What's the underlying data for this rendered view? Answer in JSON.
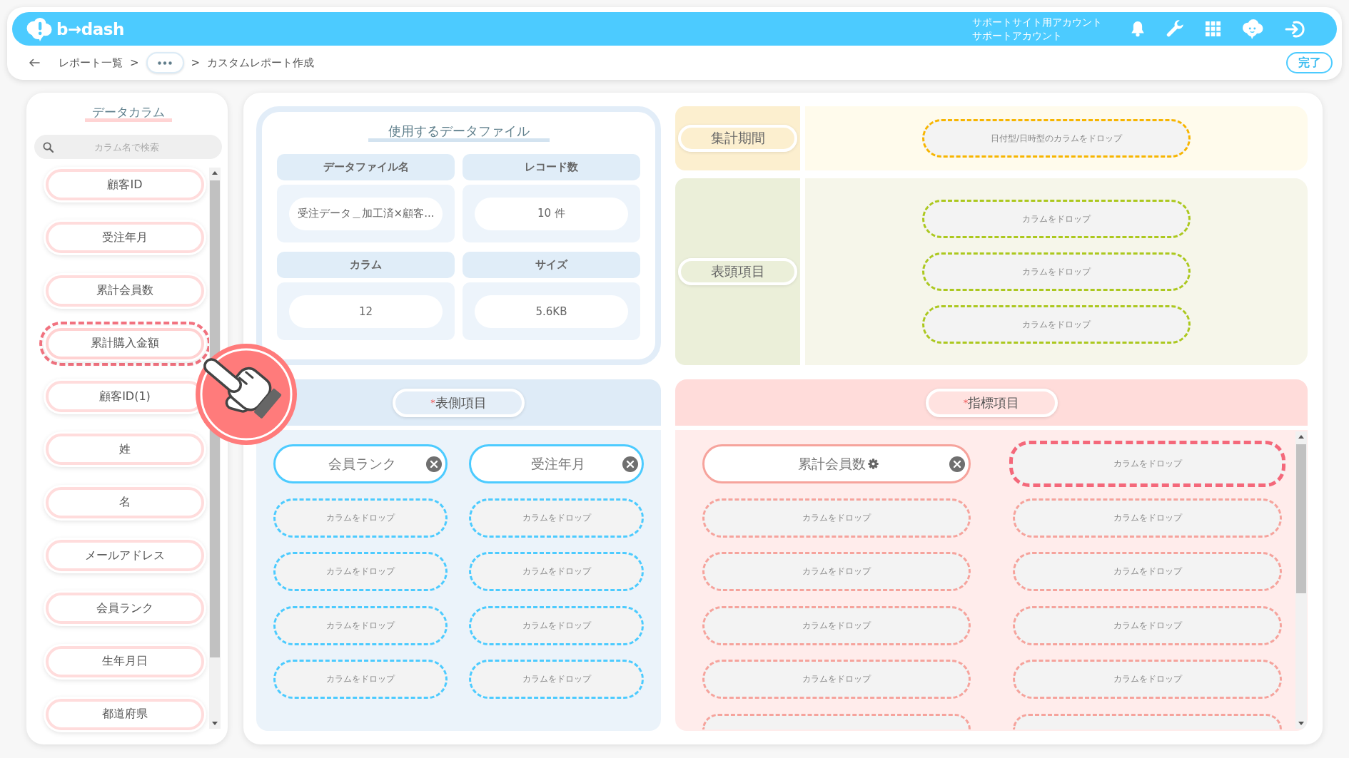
{
  "header": {
    "logo": "b→dash",
    "account_lines": [
      "サポートサイト用アカウント",
      "サポートアカウント"
    ]
  },
  "breadcrumb": [
    {
      "kind": "link",
      "label": "レポート一覧"
    },
    {
      "kind": "separator",
      "label": ">"
    },
    {
      "kind": "more"
    },
    {
      "kind": "separator",
      "label": ">"
    },
    {
      "kind": "current",
      "label": "カスタムレポート作成"
    }
  ],
  "done_button": "完了",
  "sidebar": {
    "title": "データカラム",
    "search": {
      "placeholder": "カラム名で検索"
    },
    "items": [
      {
        "label": "顧客ID",
        "dragging": false
      },
      {
        "label": "受注年月",
        "dragging": false
      },
      {
        "label": "累計会員数",
        "dragging": false
      },
      {
        "label": "累計購入金額",
        "dragging": true
      },
      {
        "label": "顧客ID(1)",
        "dragging": false
      },
      {
        "label": "姓",
        "dragging": false
      },
      {
        "label": "名",
        "dragging": false
      },
      {
        "label": "メールアドレス",
        "dragging": false
      },
      {
        "label": "会員ランク",
        "dragging": false
      },
      {
        "label": "生年月日",
        "dragging": false
      },
      {
        "label": "都道府県",
        "dragging": false
      }
    ]
  },
  "data_file": {
    "title": "使用するデータファイル",
    "fields": [
      {
        "label": "データファイル名",
        "value": "受注データ＿加工済×顧客..."
      },
      {
        "label": "レコード数",
        "value": "10 件"
      },
      {
        "label": "カラム",
        "value": "12"
      },
      {
        "label": "サイズ",
        "value": "5.6KB"
      }
    ]
  },
  "period": {
    "label": "集計期間",
    "slots": [
      {
        "kind": "drop",
        "placeholder": "日付型/日時型のカラムをドロップ"
      }
    ]
  },
  "column_header": {
    "label": "表頭項目",
    "slots": [
      {
        "kind": "drop",
        "placeholder": "カラムをドロップ"
      },
      {
        "kind": "drop",
        "placeholder": "カラムをドロップ"
      },
      {
        "kind": "drop",
        "placeholder": "カラムをドロップ"
      }
    ]
  },
  "row_header": {
    "label": "$^{*}$表側項目",
    "slots": [
      {
        "kind": "column",
        "label": "会員ランク",
        "settings": false
      },
      {
        "kind": "column",
        "label": "受注年月",
        "settings": false
      },
      {
        "kind": "drop",
        "placeholder": "カラムをドロップ"
      },
      {
        "kind": "drop",
        "placeholder": "カラムをドロップ"
      },
      {
        "kind": "drop",
        "placeholder": "カラムをドロップ"
      },
      {
        "kind": "drop",
        "placeholder": "カラムをドロップ"
      },
      {
        "kind": "drop",
        "placeholder": "カラムをドロップ"
      },
      {
        "kind": "drop",
        "placeholder": "カラムをドロップ"
      },
      {
        "kind": "drop",
        "placeholder": "カラムをドロップ"
      },
      {
        "kind": "drop",
        "placeholder": "カラムをドロップ"
      }
    ]
  },
  "metrics": {
    "label": "$^{*}$指標項目",
    "slots": [
      {
        "kind": "column",
        "label": "累計会員数",
        "settings": true,
        "hover": false
      },
      {
        "kind": "drop",
        "placeholder": "カラムをドロップ",
        "hover": true
      },
      {
        "kind": "drop",
        "placeholder": "カラムをドロップ",
        "hover": false
      },
      {
        "kind": "drop",
        "placeholder": "カラムをドロップ",
        "hover": false
      },
      {
        "kind": "drop",
        "placeholder": "カラムをドロップ",
        "hover": false
      },
      {
        "kind": "drop",
        "placeholder": "カラムをドロップ",
        "hover": false
      },
      {
        "kind": "drop",
        "placeholder": "カラムをドロップ",
        "hover": false
      },
      {
        "kind": "drop",
        "placeholder": "カラムをドロップ",
        "hover": false
      },
      {
        "kind": "drop",
        "placeholder": "カラムをドロップ",
        "hover": false
      },
      {
        "kind": "drop",
        "placeholder": "カラムをドロップ",
        "hover": false
      },
      {
        "kind": "cut",
        "hover": false
      },
      {
        "kind": "cut",
        "hover": false
      }
    ]
  }
}
